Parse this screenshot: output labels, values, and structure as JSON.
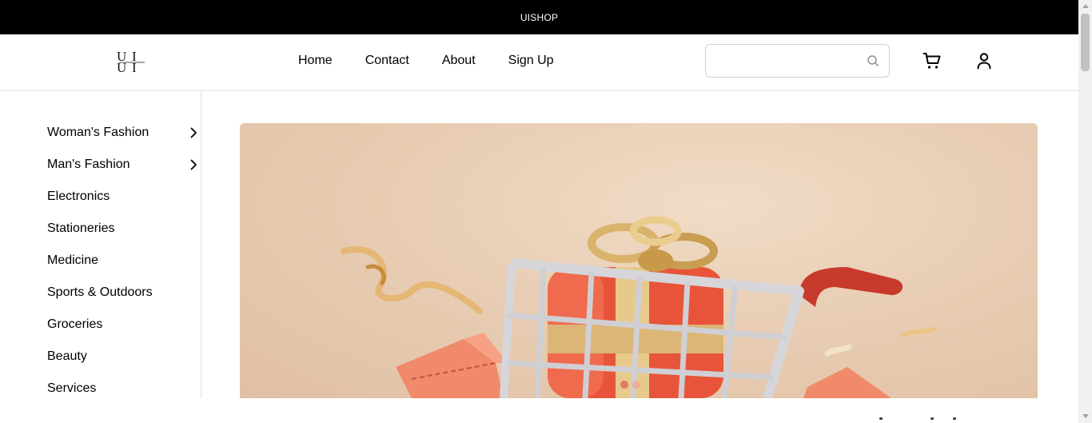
{
  "topbar": {
    "text": "UISHOP"
  },
  "header": {
    "logo_alt": "UI SHOP",
    "nav": [
      {
        "label": "Home"
      },
      {
        "label": "Contact"
      },
      {
        "label": "About"
      },
      {
        "label": "Sign Up"
      }
    ],
    "search": {
      "value": "",
      "placeholder": "",
      "icon": "search-icon"
    },
    "cart_icon": "cart-icon",
    "account_icon": "user-icon"
  },
  "sidebar": {
    "categories": [
      {
        "label": "Woman's Fashion",
        "has_submenu": true
      },
      {
        "label": "Man's Fashion",
        "has_submenu": true
      },
      {
        "label": "Electronics",
        "has_submenu": false
      },
      {
        "label": "Stationeries",
        "has_submenu": false
      },
      {
        "label": "Medicine",
        "has_submenu": false
      },
      {
        "label": "Sports & Outdoors",
        "has_submenu": false
      },
      {
        "label": "Groceries",
        "has_submenu": false
      },
      {
        "label": "Beauty",
        "has_submenu": false
      },
      {
        "label": "Services",
        "has_submenu": false
      }
    ]
  },
  "banner": {
    "image": "shopping-cart-with-gift",
    "carousel": {
      "slides": 2,
      "active_index": 0
    }
  },
  "colors": {
    "topbar_bg": "#000000",
    "banner_bg": "#e8cdb4",
    "gift_red": "#e8543a",
    "ribbon_gold": "#d9b36c",
    "cart_silver": "#d6d6da"
  }
}
